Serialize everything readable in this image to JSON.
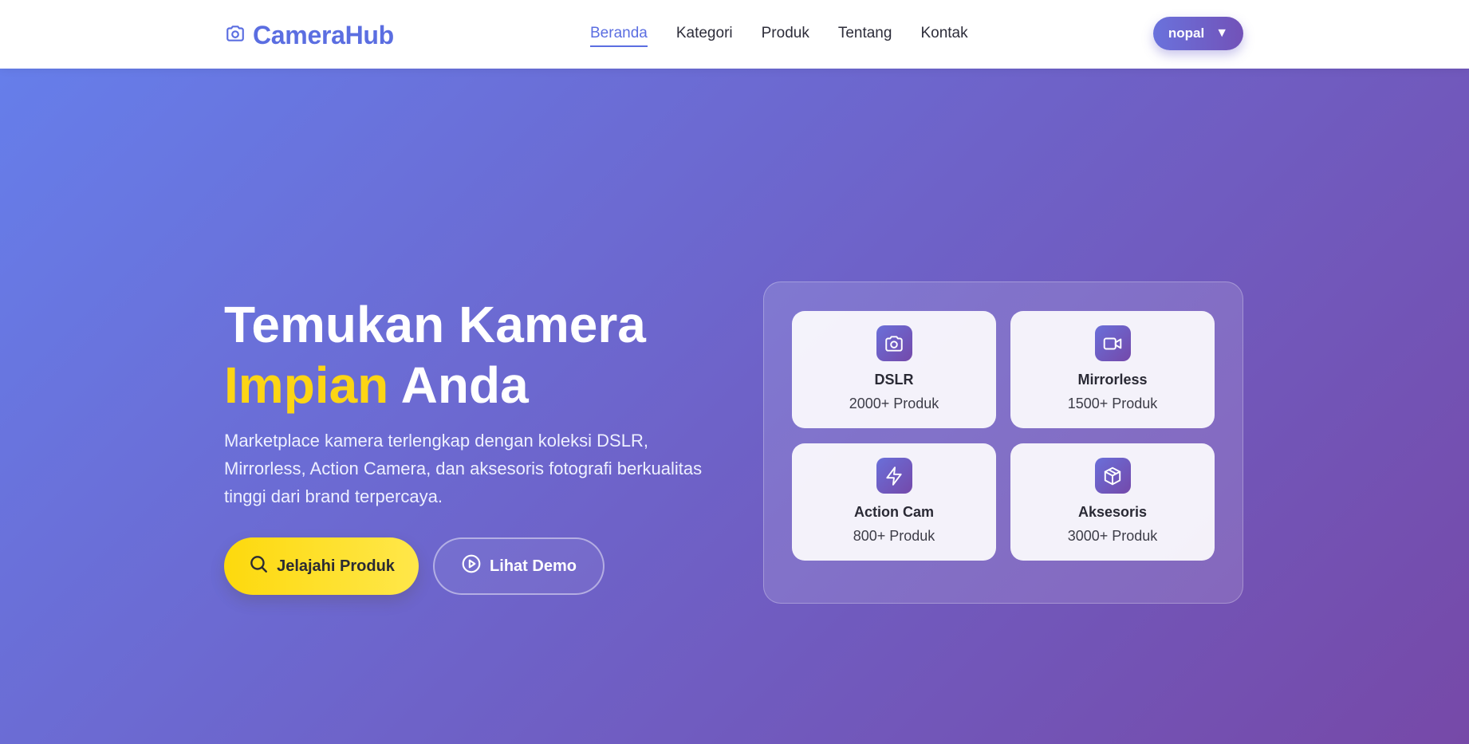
{
  "header": {
    "logo_text": "CameraHub",
    "logo_icon": "camera-icon",
    "nav": [
      {
        "label": "Beranda",
        "active": true
      },
      {
        "label": "Kategori",
        "active": false
      },
      {
        "label": "Produk",
        "active": false
      },
      {
        "label": "Tentang",
        "active": false
      },
      {
        "label": "Kontak",
        "active": false
      }
    ],
    "user": {
      "name": "nopal",
      "caret": "▼"
    }
  },
  "hero": {
    "title_line1": "Temukan Kamera",
    "title_accent": "Impian",
    "title_rest": "Anda",
    "description": "Marketplace kamera terlengkap dengan koleksi DSLR, Mirrorless, Action Camera, dan aksesoris fotografi berkualitas tinggi dari brand terpercaya.",
    "primary_button": {
      "label": "Jelajahi Produk",
      "icon": "search-icon"
    },
    "secondary_button": {
      "label": "Lihat Demo",
      "icon": "play-circle-icon"
    }
  },
  "categories": [
    {
      "name": "DSLR",
      "count": "2000+ Produk",
      "icon": "camera-icon"
    },
    {
      "name": "Mirrorless",
      "count": "1500+ Produk",
      "icon": "video-icon"
    },
    {
      "name": "Action Cam",
      "count": "800+ Produk",
      "icon": "lightning-icon"
    },
    {
      "name": "Aksesoris",
      "count": "3000+ Produk",
      "icon": "box-icon"
    }
  ],
  "colors": {
    "brand": "#5b6ee1",
    "accent_yellow": "#fcd514",
    "hero_gradient_start": "#667eea",
    "hero_gradient_end": "#7649a8"
  }
}
